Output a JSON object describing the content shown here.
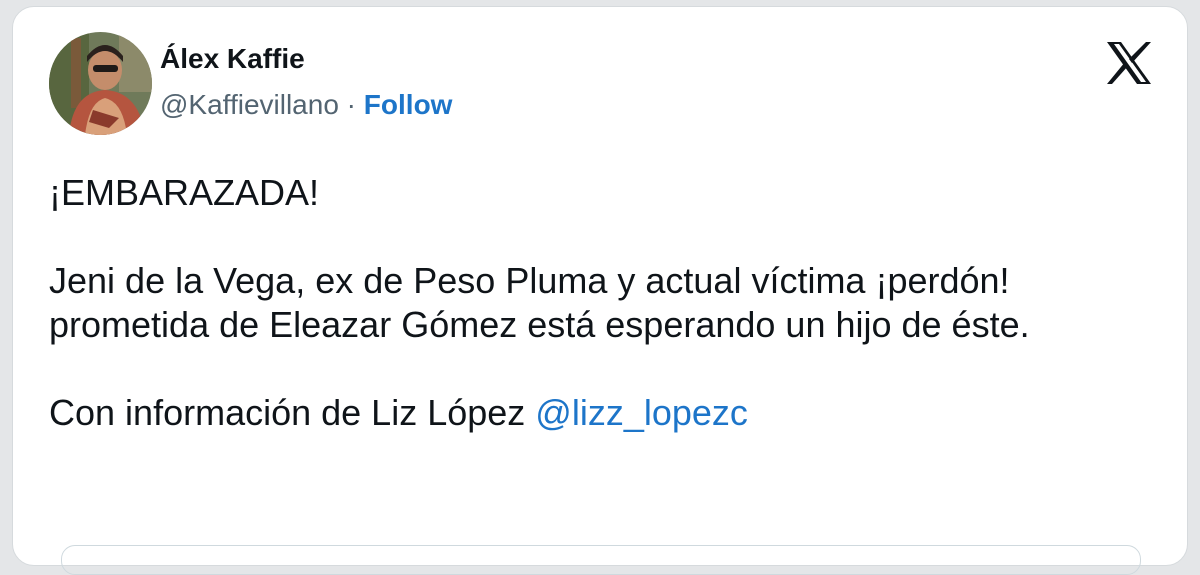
{
  "author": {
    "display_name": "Álex Kaffie",
    "handle": "@Kaffievillano",
    "separator": " · ",
    "follow_label": "Follow"
  },
  "platform_icon": "x-logo-icon",
  "tweet": {
    "line1": "¡EMBARAZADA!",
    "paragraph2": "Jeni de la Vega, ex de Peso Pluma y actual víctima ¡perdón! prometida de Eleazar Gómez está esperando un hijo de éste.",
    "paragraph3_text": "Con información de Liz López ",
    "paragraph3_mention": "@lizz_lopezc"
  },
  "colors": {
    "link": "#1d75c9",
    "text": "#0f1419",
    "secondary": "#536471"
  }
}
